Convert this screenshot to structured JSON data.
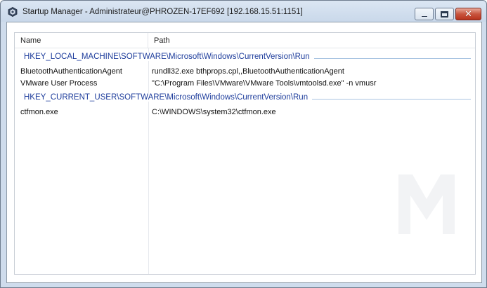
{
  "window": {
    "title": "Startup Manager - Administrateur@PHROZEN-17EF692 [192.168.15.51:1151]",
    "icon": "startup-manager-app-icon",
    "controls": [
      "minimize",
      "maximize",
      "close"
    ]
  },
  "list": {
    "columns": [
      "Name",
      "Path"
    ],
    "groups": [
      {
        "key": "HKEY_LOCAL_MACHINE\\SOFTWARE\\Microsoft\\Windows\\CurrentVersion\\Run",
        "entries": [
          {
            "name": "BluetoothAuthenticationAgent",
            "path": "rundll32.exe bthprops.cpl,,BluetoothAuthenticationAgent"
          },
          {
            "name": "VMware User Process",
            "path": "\"C:\\Program Files\\VMware\\VMware Tools\\vmtoolsd.exe\" -n vmusr"
          }
        ]
      },
      {
        "key": "HKEY_CURRENT_USER\\SOFTWARE\\Microsoft\\Windows\\CurrentVersion\\Run",
        "entries": [
          {
            "name": "ctfmon.exe",
            "path": "C:\\WINDOWS\\system32\\ctfmon.exe"
          }
        ]
      }
    ]
  },
  "colors": {
    "group_header_text": "#1e3d9c",
    "group_line": "#a9c4e2",
    "frame": "#cfdcec",
    "close_button": "#c8553e"
  }
}
